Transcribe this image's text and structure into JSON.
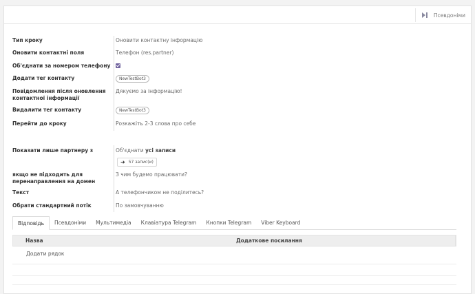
{
  "smart_button": {
    "label": "Псевдоніми",
    "icon": "step-forward-icon"
  },
  "fields": [
    {
      "label": "Тип кроку",
      "value": "Оновити контактну інформацію"
    },
    {
      "label": "Оновити контактні поля",
      "value": "Телефон (res.partner)"
    },
    {
      "label": "Об'єднати за номером телефону",
      "checked": true
    },
    {
      "label": "Додати тег контакту",
      "tag": "NewTestBot3"
    },
    {
      "label": "Повідомлення після оновлення контактної інформації",
      "value": "Дякуємо за інформацію!"
    },
    {
      "label": "Видалити тег контакту",
      "tag": "NewTestBot3"
    },
    {
      "label": "Перейти до кроку",
      "value": "Розкажіть 2-3 слова про себе"
    }
  ],
  "fields2": [
    {
      "label": "Показати лише партнеру з",
      "value": "Об'єднати ",
      "value_bold": "усі записи",
      "records_button": "57 запис(и)"
    },
    {
      "label": "якщо не підходить для перенаправлення на домен",
      "value": "З чим будемо працювати?"
    },
    {
      "label": "Текст",
      "value": "А телефончиком не поділитесь?"
    },
    {
      "label": "Обрати стандартний потік",
      "value": "По замовчуванню"
    }
  ],
  "tabs": [
    "Відповідь",
    "Псевдоніми",
    "Мультимедіа",
    "Клавіатура Telegram",
    "Кнопки Telegram",
    "Viber Keyboard"
  ],
  "active_tab": "Відповідь",
  "table": {
    "columns": [
      "Назва",
      "Додаткове посилання"
    ],
    "add_line": "Додати рядок"
  },
  "accent_color": "#71639e"
}
